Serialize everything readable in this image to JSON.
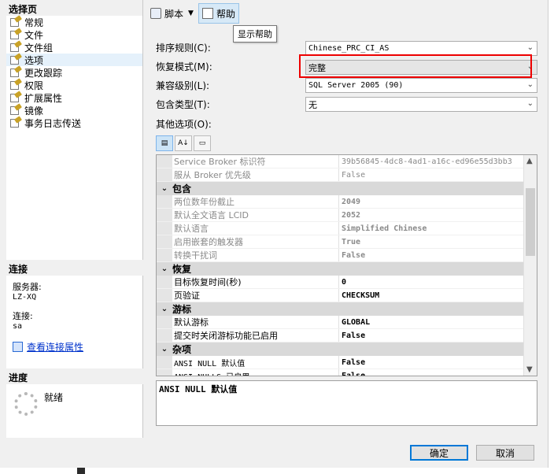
{
  "left": {
    "select_page_title": "选择页",
    "pages": [
      "常规",
      "文件",
      "文件组",
      "选项",
      "更改跟踪",
      "权限",
      "扩展属性",
      "镜像",
      "事务日志传送"
    ],
    "selected_index": 3,
    "connection_title": "连接",
    "server_label": "服务器:",
    "server_value": "LZ-XQ",
    "conn_label": "连接:",
    "conn_value": "sa",
    "view_conn_link": "查看连接属性",
    "progress_title": "进度",
    "progress_status": "就绪"
  },
  "toolbar": {
    "script_label": "脚本",
    "help_label": "帮助",
    "tooltip": "显示帮助"
  },
  "form": {
    "collation_label": "排序规则(C):",
    "collation_value": "Chinese_PRC_CI_AS",
    "recovery_label": "恢复模式(M):",
    "recovery_value": "完整",
    "compat_label": "兼容级别(L):",
    "compat_value": "SQL Server 2005 (90)",
    "containment_label": "包含类型(T):",
    "containment_value": "无",
    "other_label": "其他选项(O):"
  },
  "grid": {
    "top_rows": [
      {
        "name": "Service Broker 标识符",
        "value": "39b56845-4dc8-4ad1-a16c-ed96e55d3bb3"
      },
      {
        "name": "服从 Broker 优先级",
        "value": "False"
      }
    ],
    "cat_containment": "包含",
    "containment_rows": [
      {
        "name": "两位数年份截止",
        "value": "2049"
      },
      {
        "name": "默认全文语言 LCID",
        "value": "2052"
      },
      {
        "name": "默认语言",
        "value": "Simplified Chinese"
      },
      {
        "name": "启用嵌套的触发器",
        "value": "True"
      },
      {
        "name": "转换干扰词",
        "value": "False"
      }
    ],
    "cat_recovery": "恢复",
    "recovery_rows": [
      {
        "name": "目标恢复时间(秒)",
        "value": "0"
      },
      {
        "name": "页验证",
        "value": "CHECKSUM"
      }
    ],
    "cat_cursor": "游标",
    "cursor_rows": [
      {
        "name": "默认游标",
        "value": "GLOBAL"
      },
      {
        "name": "提交时关闭游标功能已启用",
        "value": "False"
      }
    ],
    "cat_misc": "杂项",
    "misc_rows": [
      {
        "name": "ANSI NULL 默认值",
        "value": "False"
      },
      {
        "name": "ANSI NULLS 已启用",
        "value": "False"
      }
    ]
  },
  "description": "ANSI NULL 默认值",
  "buttons": {
    "ok": "确定",
    "cancel": "取消"
  }
}
